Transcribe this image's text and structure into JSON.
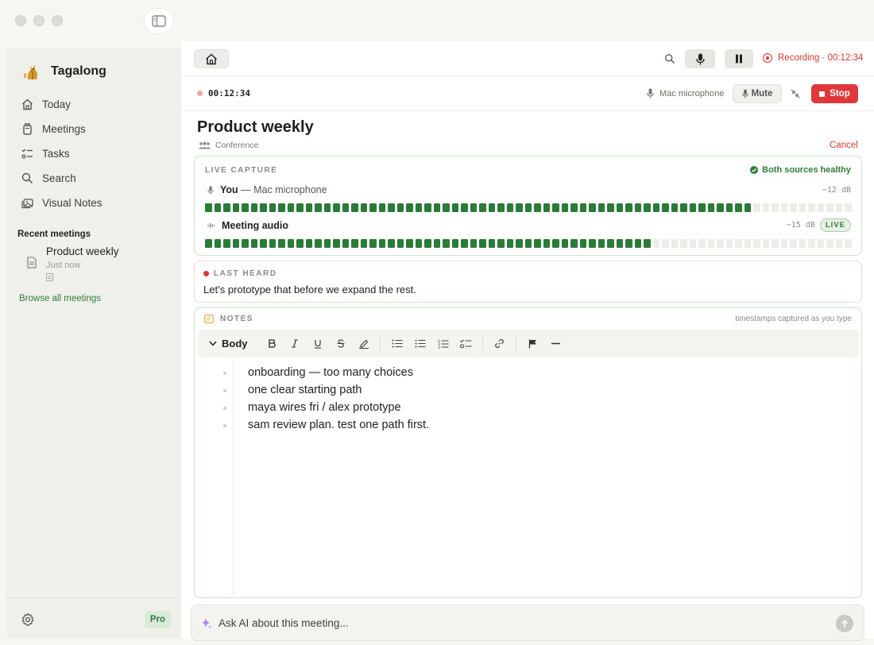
{
  "app": {
    "name": "Tagalong"
  },
  "sidebar": {
    "items": [
      {
        "label": "Today",
        "icon": "home-icon"
      },
      {
        "label": "Meetings",
        "icon": "meetings-icon"
      },
      {
        "label": "Tasks",
        "icon": "tasks-icon"
      },
      {
        "label": "Search",
        "icon": "search-icon"
      },
      {
        "label": "Visual Notes",
        "icon": "visual-notes-icon"
      }
    ],
    "recent_title": "Recent meetings",
    "recent": [
      {
        "title": "Product weekly",
        "time": "Just now"
      }
    ],
    "browse_label": "Browse all meetings",
    "pro_label": "Pro"
  },
  "topbar": {
    "recording_status": "Recording · 00:12:34"
  },
  "recording": {
    "timer": "00:12:34",
    "source": "Mac microphone",
    "mute_label": "Mute",
    "stop_label": "Stop"
  },
  "meeting": {
    "title": "Product weekly",
    "type": "Conference",
    "cancel_label": "Cancel"
  },
  "capture": {
    "label": "LIVE CAPTURE",
    "health": "Both sources healthy",
    "sources": [
      {
        "name": "You",
        "detail": "— Mac microphone",
        "level_db": "−12 dB",
        "fill": 0.845,
        "icon": "mic-icon"
      },
      {
        "name": "Meeting audio",
        "detail": "",
        "level_db": "−15 dB",
        "fill": 0.69,
        "icon": "audio-wave-icon",
        "badge": "LIVE"
      }
    ]
  },
  "last_heard": {
    "label": "LAST HEARD",
    "text": "Let’s prototype that before we expand the rest."
  },
  "notes": {
    "label": "NOTES",
    "hint": "timestamps captured as you type",
    "style_label": "Body",
    "bullets": [
      "onboarding — too many choices",
      "one clear starting path",
      "maya wires fri / alex prototype",
      "sam review plan. test one path first."
    ]
  },
  "ask": {
    "placeholder": "Ask AI about this meeting..."
  },
  "colors": {
    "accent_green": "#2b7a38",
    "stop_red": "#e0383a",
    "recording_red": "#d23a32"
  }
}
